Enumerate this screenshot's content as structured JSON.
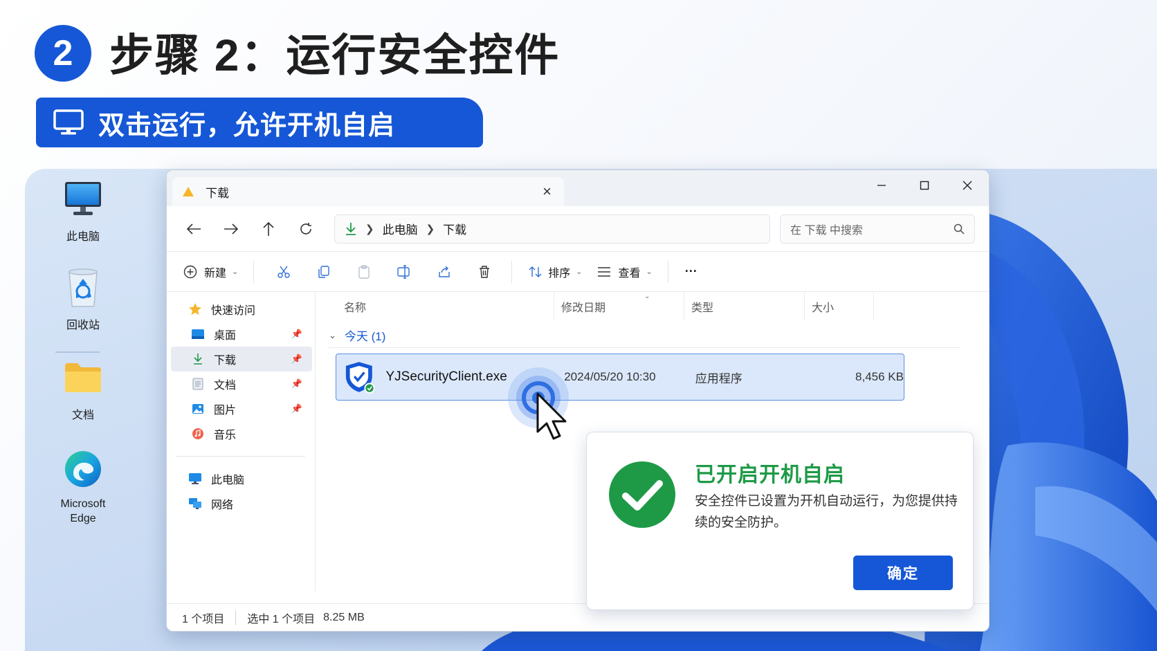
{
  "header": {
    "step_number": "2",
    "title": "步骤 2：运行安全控件",
    "subtitle": "双击运行，允许开机自启"
  },
  "desktop": {
    "icons": [
      {
        "label": "此电脑"
      },
      {
        "label": "回收站"
      },
      {
        "label": "文档"
      },
      {
        "label": "Microsoft Edge"
      }
    ]
  },
  "window": {
    "tab_label": "下载",
    "address": {
      "part1": "此电脑",
      "part2": "下载"
    },
    "search_placeholder": "在 下载 中搜索",
    "toolbar": {
      "new_label": "新建",
      "sort_label": "排序",
      "view_label": "查看",
      "more_label": "···"
    },
    "sidebar": [
      {
        "label": "快速访问"
      },
      {
        "label": "桌面"
      },
      {
        "label": "下载"
      },
      {
        "label": "文档"
      },
      {
        "label": "图片"
      },
      {
        "label": "音乐"
      },
      {
        "label": "此电脑"
      },
      {
        "label": "网络"
      }
    ],
    "columns": {
      "name": "名称",
      "date": "修改日期",
      "type": "类型",
      "size": "大小"
    },
    "group_label": "今天 (1)",
    "file": {
      "name": "YJSecurityClient.exe",
      "date": "2024/05/20 10:30",
      "type": "应用程序",
      "size": "8,456 KB"
    },
    "status": {
      "items": "1 个项目",
      "selected": "选中 1 个项目",
      "selected_size": "8.25 MB"
    }
  },
  "dialog": {
    "title": "已开启开机自启",
    "body": "安全控件已设置为开机自动运行，为您提供持续的安全防护。",
    "ok_label": "确定"
  },
  "colors": {
    "accent": "#1557d6",
    "success": "#1e9a47"
  }
}
